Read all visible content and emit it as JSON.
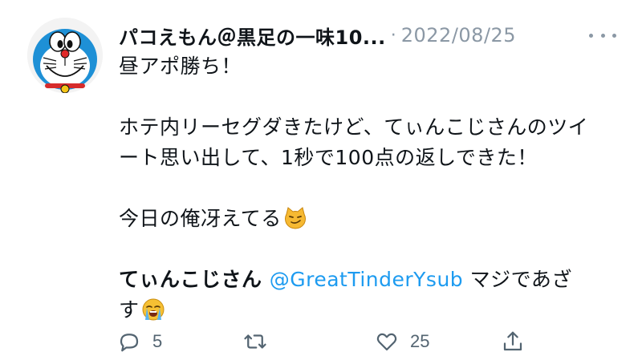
{
  "tweet": {
    "author_name": "パコえもん＠黒足の一味10...",
    "separator": "·",
    "date": "2022/08/25",
    "body": {
      "line1": "昼アポ勝ち！",
      "line2": "ホテ内リーセグダきたけど、てぃんこじさんのツイ",
      "line3": "ート思い出して、1秒で100点の返しできた！",
      "line4": "今日の俺冴えてる",
      "line5_prefix": "てぃんこじさん ",
      "line5_mention": "@GreatTinderYsub",
      "line5_suffix": " マジであざ",
      "line6": "す"
    },
    "emoji": {
      "smirk_cat": "smirking-cat-emoji",
      "crying": "loudly-crying-face-emoji"
    }
  },
  "actions": {
    "reply_count": "5",
    "retweet_count": "",
    "like_count": "25"
  },
  "icons": {
    "avatar": "doraemon-avatar",
    "more": "more-options-icon",
    "reply": "reply-icon",
    "retweet": "retweet-icon",
    "like": "like-icon",
    "share": "share-icon"
  }
}
